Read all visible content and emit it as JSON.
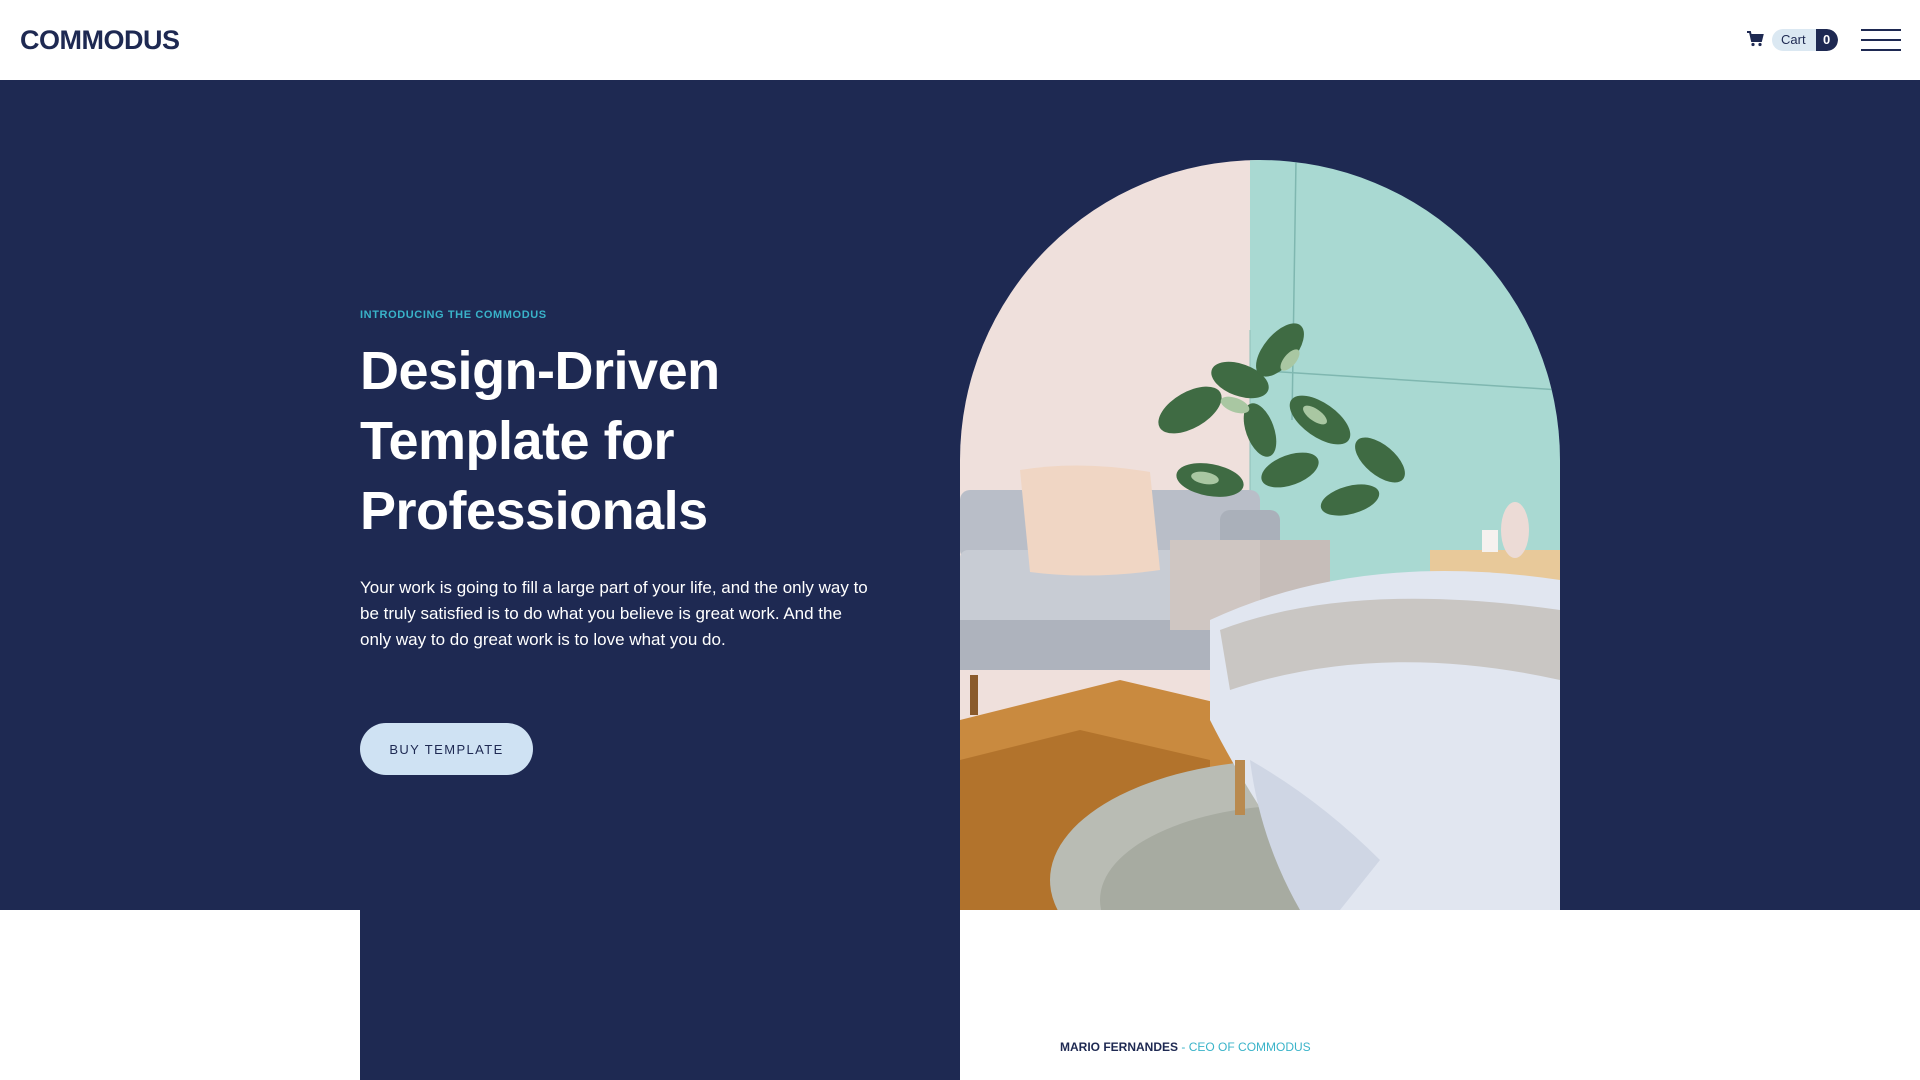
{
  "header": {
    "logo_text": "COMMODUS",
    "cart_label": "Cart",
    "cart_count": "0",
    "menu_icon": "hamburger-menu-icon",
    "cart_icon": "shopping-cart-icon"
  },
  "hero": {
    "eyebrow": "INTRODUCING THE COMMODUS",
    "headline_lines": [
      "Design-Driven",
      "Template for",
      "Professionals"
    ],
    "description": "Your work is going to fill a large part of your life, and the only way to be truly satisfied is to do what you believe is great work. And the only way to do great work is to love what you do.",
    "cta_label": "BUY TEMPLATE",
    "image": "bedroom-interior-photo"
  },
  "testimonial": {
    "name": "MARIO FERNANDES",
    "separator": " - ",
    "role": "CEO OF COMMODUS"
  },
  "colors": {
    "navy": "#1e2952",
    "accent_teal": "#39b3c9",
    "cta_background": "#cfe2f3",
    "cart_pill": "#dbe8f2"
  }
}
